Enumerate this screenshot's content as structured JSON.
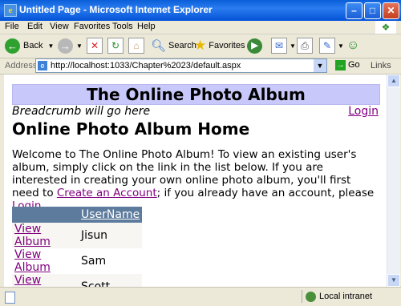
{
  "window": {
    "title": "Untitled Page - Microsoft Internet Explorer",
    "minimize": "–",
    "maximize": "□",
    "close": "✕"
  },
  "menu": [
    "File",
    "Edit",
    "View",
    "Favorites",
    "Tools",
    "Help"
  ],
  "toolbar": {
    "back": "Back",
    "search": "Search",
    "favorites": "Favorites"
  },
  "address": {
    "label": "Address",
    "url": "http://localhost:1033/Chapter%2023/default.aspx",
    "go": "Go",
    "links": "Links"
  },
  "page": {
    "header": "The Online Photo Album",
    "breadcrumb": "Breadcrumb will go here",
    "login": "Login",
    "title": "Online Photo Album Home",
    "intro_1": "Welcome to The Online Photo Album! To view an existing user's album, simply click on the link in the list below. If you are interested in creating your own online photo album, you'll first need to ",
    "create_link": "Create an Account",
    "intro_2": "; if you already have an account, please ",
    "login_link": "Login",
    "intro_3": ".",
    "table": {
      "header": "UserName",
      "link_label": "View Album",
      "rows": [
        "Jisun",
        "Sam",
        "Scott"
      ]
    }
  },
  "status": {
    "zone": "Local intranet"
  },
  "icons": {
    "back": "back-arrow-icon",
    "forward": "forward-arrow-icon",
    "stop": "stop-icon",
    "refresh": "refresh-icon",
    "home": "home-icon",
    "search": "search-icon",
    "favorites": "star-icon",
    "media": "media-icon",
    "mail": "mail-icon",
    "print": "print-icon",
    "edit": "edit-icon",
    "messenger": "messenger-icon"
  }
}
